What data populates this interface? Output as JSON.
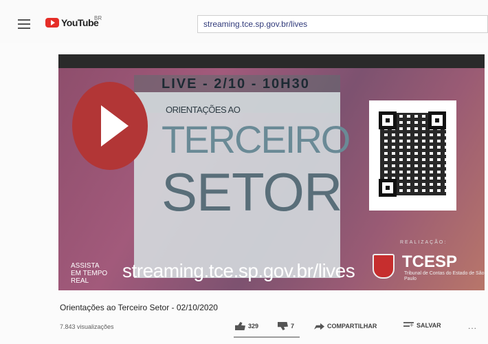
{
  "header": {
    "logo_text": "YouTube",
    "logo_country": "BR",
    "search_value": "streaming.tce.sp.gov.br/lives"
  },
  "video": {
    "live_line": "LIVE - 2/10 - 10H30",
    "subtitle": "ORIENTAÇÕES AO",
    "title_line1": "TERCEIRO",
    "title_line2": "SETOR",
    "assista": "ASSISTA EM TEMPO REAL",
    "url": "streaming.tce.sp.gov.br/lives",
    "realizacao": "REALIZAÇÃO:",
    "org_name": "TCESP",
    "org_sub": "Tribunal de Contas do Estado de São Paulo"
  },
  "info": {
    "title": "Orientações ao Terceiro Setor - 02/10/2020",
    "views": "7.843 visualizações",
    "likes": "329",
    "dislikes": "7",
    "share_label": "COMPARTILHAR",
    "save_label": "SALVAR",
    "more": "..."
  },
  "colors": {
    "brand_red": "#e52d27",
    "link_blue": "#303a7a"
  }
}
